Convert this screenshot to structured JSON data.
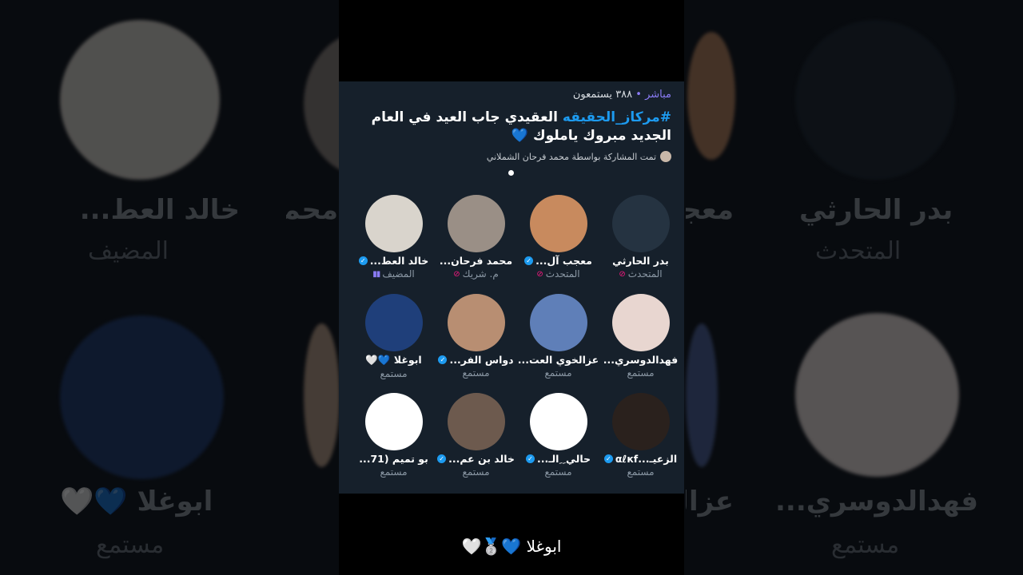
{
  "header": {
    "live_label": "مباشر",
    "listeners": "٣٨٨ يستمعون"
  },
  "title": {
    "hashtag": "#مركاز_الحقيقه",
    "text": " العقيدي جاب العيد في العام الجديد  مبروك ياملوك 💙"
  },
  "shared_by": "تمت المشاركة بواسطة محمد فرحان الشملاني",
  "participants": [
    {
      "name": "بدر الحارثي",
      "role": "المتحدث",
      "icon": "mic-off-icon",
      "verified": false,
      "color": "#253341"
    },
    {
      "name": "معجب آل...",
      "role": "المتحدث",
      "icon": "mic-off-icon",
      "verified": true,
      "color": "#c88a5e"
    },
    {
      "name": "محمد فرحان...",
      "role": "م. شريك",
      "icon": "mic-off-icon",
      "verified": false,
      "color": "#9a8f86"
    },
    {
      "name": "خالد العط...",
      "role": "المضيف",
      "icon": "host-icon",
      "verified": true,
      "color": "#d9d4cc"
    },
    {
      "name": "فهدالدوسري...",
      "role": "مستمع",
      "icon": "",
      "verified": false,
      "color": "#e8d6d0"
    },
    {
      "name": "عزالخوي العت...",
      "role": "مستمع",
      "icon": "",
      "verified": false,
      "color": "#5f7fb8"
    },
    {
      "name": "دواس الفر...",
      "role": "مستمع",
      "icon": "",
      "verified": true,
      "color": "#b88e72"
    },
    {
      "name": "ابوغلا 💙🤍",
      "role": "مستمع",
      "icon": "",
      "verified": false,
      "color": "#1f3f7a"
    },
    {
      "name": "الزعيـ...αℓкf",
      "role": "مستمع",
      "icon": "",
      "verified": true,
      "color": "#2a211d"
    },
    {
      "name": "حالي ِ ِالـ...",
      "role": "مستمع",
      "icon": "",
      "verified": true,
      "color": "#ffffff"
    },
    {
      "name": "خالد بن عم...",
      "role": "مستمع",
      "icon": "",
      "verified": true,
      "color": "#6d5a4e"
    },
    {
      "name": "بو تميم (71...",
      "role": "مستمع",
      "icon": "",
      "verified": false,
      "color": "#ffffff"
    }
  ],
  "caption": "ابوغلا 💙🥈🤍",
  "background": {
    "names": [
      "خالد العط...",
      "محمد فرحان...",
      "معجب آل...",
      "بدر الحارثي",
      "ابوغلا 💙🤍",
      "عزال...",
      "فهدالدوسري..."
    ],
    "roles": [
      "المضيف",
      "المتحدث",
      "مستمع"
    ]
  },
  "colors": {
    "accent": "#1d9bf0",
    "live": "#8b7cf6",
    "card": "#16202b",
    "mute": "#f91880"
  }
}
